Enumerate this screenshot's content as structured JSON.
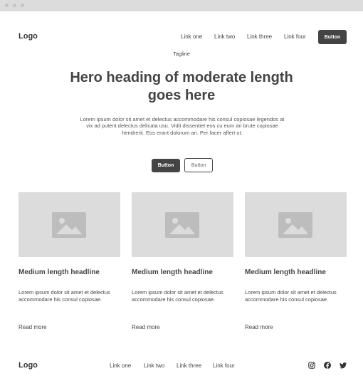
{
  "header": {
    "logo": "Logo",
    "nav": [
      "Link one",
      "Link two",
      "Link three",
      "Link four"
    ],
    "cta_label": "Button"
  },
  "hero": {
    "tagline": "Tagline",
    "heading": "Hero heading of moderate length goes here",
    "body": "Lorem ipsum dolor sit amet et delectus accommodare his consul copiosae legendos at vix ad putent delectus delicata usu. Vidit dissentiet eos cu eum an brute copiosae hendrerit. Eos erant dolorum an. Per facer affert ut.",
    "primary_button": "Button",
    "secondary_button": "Button"
  },
  "cards": [
    {
      "image_icon": "image-placeholder-icon",
      "headline": "Medium length headline",
      "text": "Lorem ipsum dolor sit amet et delectus accommodare his consul copiosae.",
      "link": "Read more"
    },
    {
      "image_icon": "image-placeholder-icon",
      "headline": "Medium length headline",
      "text": "Lorem ipsum dolor sit amet et delectus accommodare his consul copiosae.",
      "link": "Read more"
    },
    {
      "image_icon": "image-placeholder-icon",
      "headline": "Medium length headline",
      "text": "Lorem ipsum dolor sit amet et delectus accommodare his consul copiosae.",
      "link": "Read more"
    }
  ],
  "footer": {
    "logo": "Logo",
    "nav": [
      "Link one",
      "Link two",
      "Link three",
      "Link four"
    ],
    "social_icons": [
      "instagram-icon",
      "facebook-icon",
      "twitter-icon"
    ]
  },
  "colors": {
    "dark": "#444444",
    "placeholder": "#dcdcdc",
    "placeholder_icon": "#bdbdbd"
  }
}
